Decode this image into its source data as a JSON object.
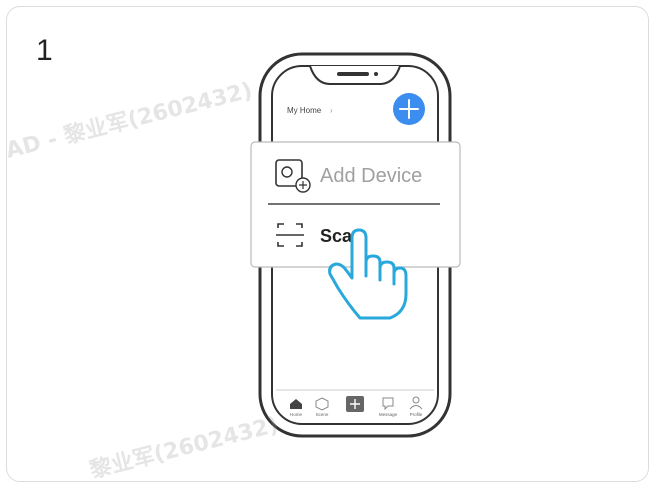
{
  "step": {
    "number": "1"
  },
  "phone": {
    "header_title": "My Home",
    "header_chevron": "›"
  },
  "popup": {
    "add_device_label": "Add Device",
    "scan_label": "Scan"
  },
  "tabbar": {
    "items": [
      {
        "label": "Home"
      },
      {
        "label": "Scene"
      },
      {
        "label": ""
      },
      {
        "label": "Message"
      },
      {
        "label": "Profile"
      }
    ]
  },
  "watermark": {
    "top_text": "AD - 黎业军(2602432)",
    "bottom_text": "黎业军(2602432)"
  },
  "colors": {
    "accent": "#3b8ef0",
    "hand": "#29a8dc",
    "outline": "#333333",
    "muted_text": "#a0a0a0"
  }
}
